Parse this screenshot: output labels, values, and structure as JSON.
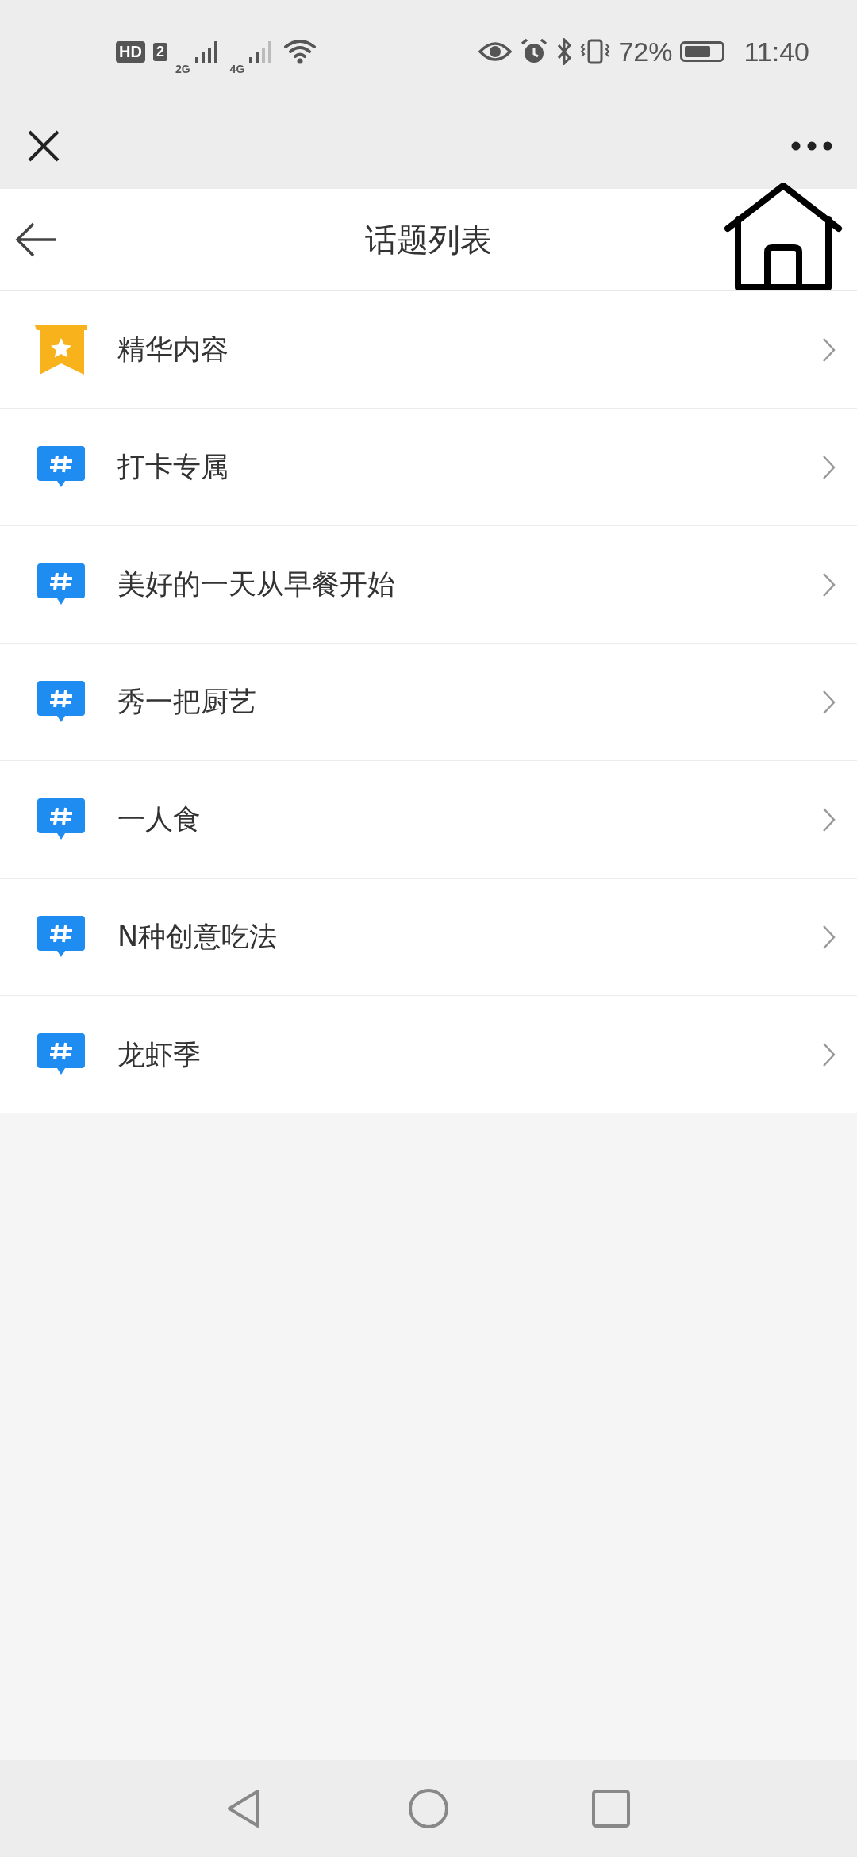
{
  "status_bar": {
    "network_labels": [
      "HD",
      "2",
      "2G",
      "4G"
    ],
    "battery": "72%",
    "time": "11:40"
  },
  "header": {
    "title": "话题列表"
  },
  "topics": [
    {
      "kind": "featured",
      "label": "精华内容"
    },
    {
      "kind": "topic",
      "label": "打卡专属"
    },
    {
      "kind": "topic",
      "label": "美好的一天从早餐开始"
    },
    {
      "kind": "topic",
      "label": "秀一把厨艺"
    },
    {
      "kind": "topic",
      "label": "一人食"
    },
    {
      "kind": "topic",
      "label": "N种创意吃法"
    },
    {
      "kind": "topic",
      "label": "龙虾季"
    }
  ]
}
